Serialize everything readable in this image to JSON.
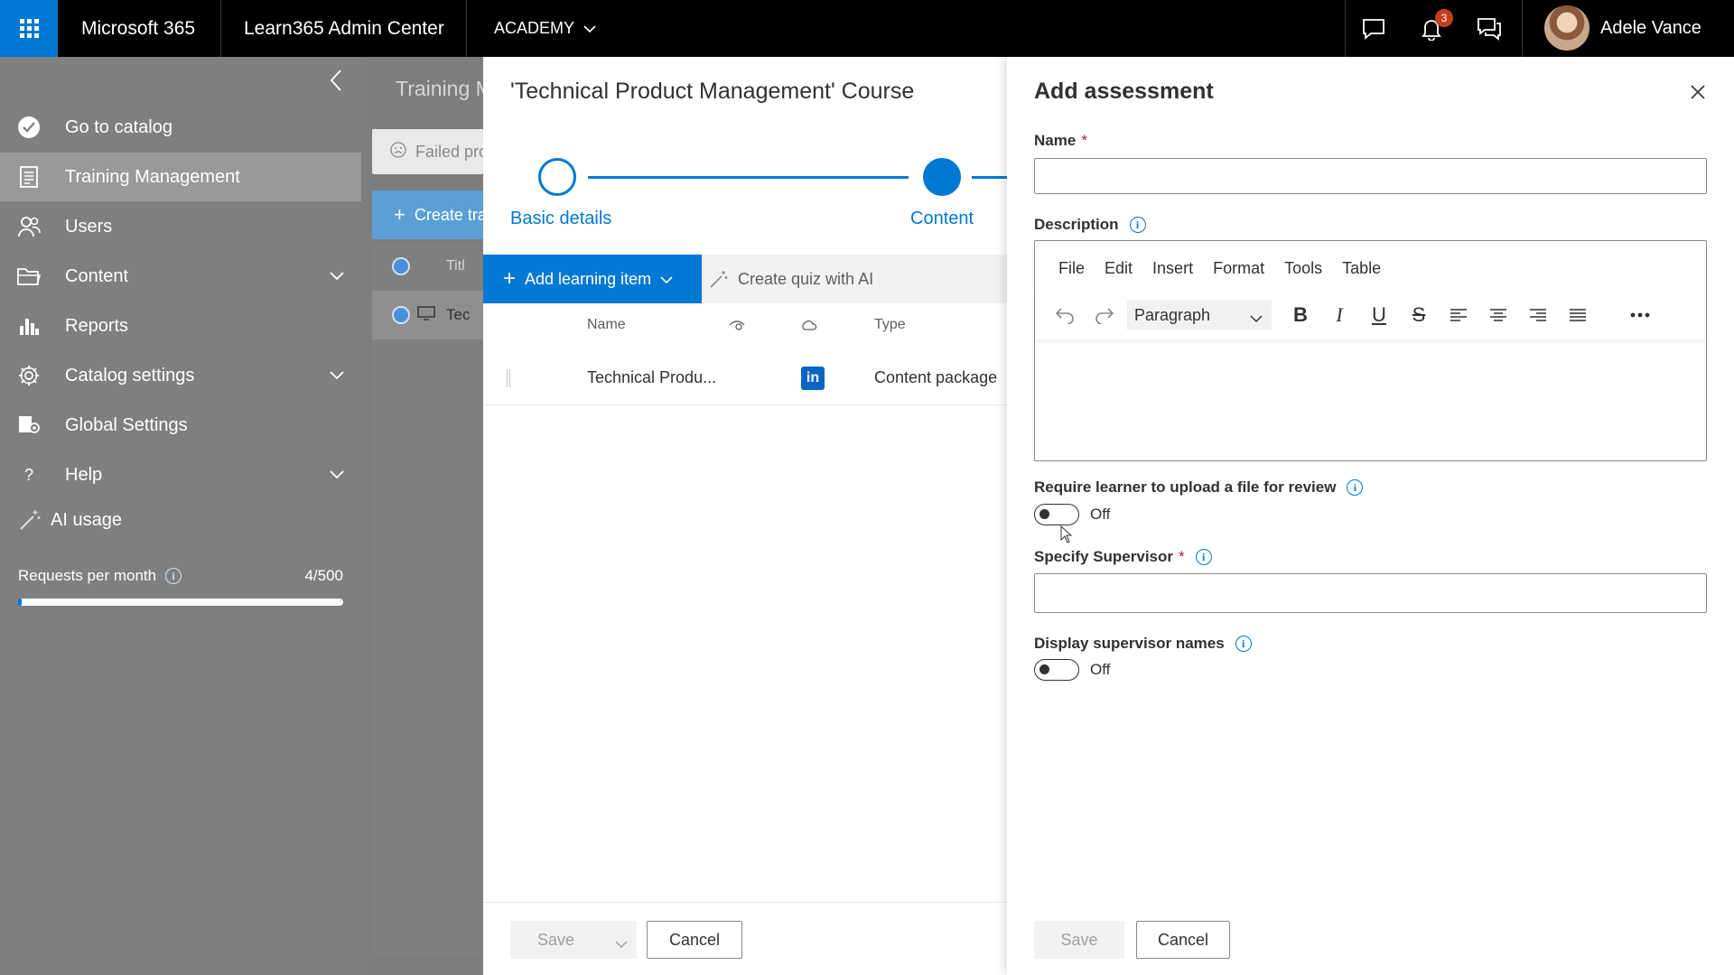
{
  "topbar": {
    "app_name": "Microsoft 365",
    "admin_center": "Learn365 Admin Center",
    "tenant": "ACADEMY",
    "notification_count": "3",
    "user_name": "Adele Vance"
  },
  "nav": {
    "items": [
      {
        "label": "Go to catalog",
        "icon": "catalog-check-icon"
      },
      {
        "label": "Training Management",
        "icon": "training-icon",
        "selected": true
      },
      {
        "label": "Users",
        "icon": "users-icon"
      },
      {
        "label": "Content",
        "icon": "folder-icon",
        "expandable": true
      },
      {
        "label": "Reports",
        "icon": "bar-chart-icon"
      },
      {
        "label": "Catalog settings",
        "icon": "gear-icon",
        "expandable": true
      },
      {
        "label": "Global Settings",
        "icon": "global-settings-icon"
      },
      {
        "label": "Help",
        "icon": "help-icon",
        "expandable": true
      }
    ],
    "ai_usage_label": "AI usage",
    "requests_label": "Requests per month",
    "requests_count": "4/500",
    "requests_fraction": 0.008
  },
  "bg_page": {
    "title": "Training M",
    "filter_placeholder": "Failed pro",
    "create_label": "Create tra",
    "col_title": "Titl",
    "row_text": "Tec"
  },
  "course": {
    "title": "'Technical Product Management' Course",
    "steps": [
      "Basic details",
      "Content"
    ],
    "add_item_label": "Add learning item",
    "create_quiz_label": "Create quiz with AI",
    "columns": {
      "name": "Name",
      "type": "Type"
    },
    "rows": [
      {
        "name": "Technical Produ...",
        "type": "Content package",
        "provider_icon": "linkedin-icon"
      }
    ],
    "save_label": "Save",
    "cancel_label": "Cancel"
  },
  "assessment": {
    "title": "Add assessment",
    "name_label": "Name",
    "name_value": "",
    "description_label": "Description",
    "editor_menu": [
      "File",
      "Edit",
      "Insert",
      "Format",
      "Tools",
      "Table"
    ],
    "paragraph_style": "Paragraph",
    "upload_label": "Require learner to upload a file for review",
    "upload_state": "Off",
    "supervisor_label": "Specify Supervisor",
    "supervisor_value": "",
    "display_names_label": "Display supervisor names",
    "display_names_state": "Off",
    "save_label": "Save",
    "cancel_label": "Cancel"
  },
  "colors": {
    "accent": "#0078d4",
    "topbar": "#000000",
    "nav_bg": "#7f7f7f",
    "badge": "#c43e1c"
  }
}
